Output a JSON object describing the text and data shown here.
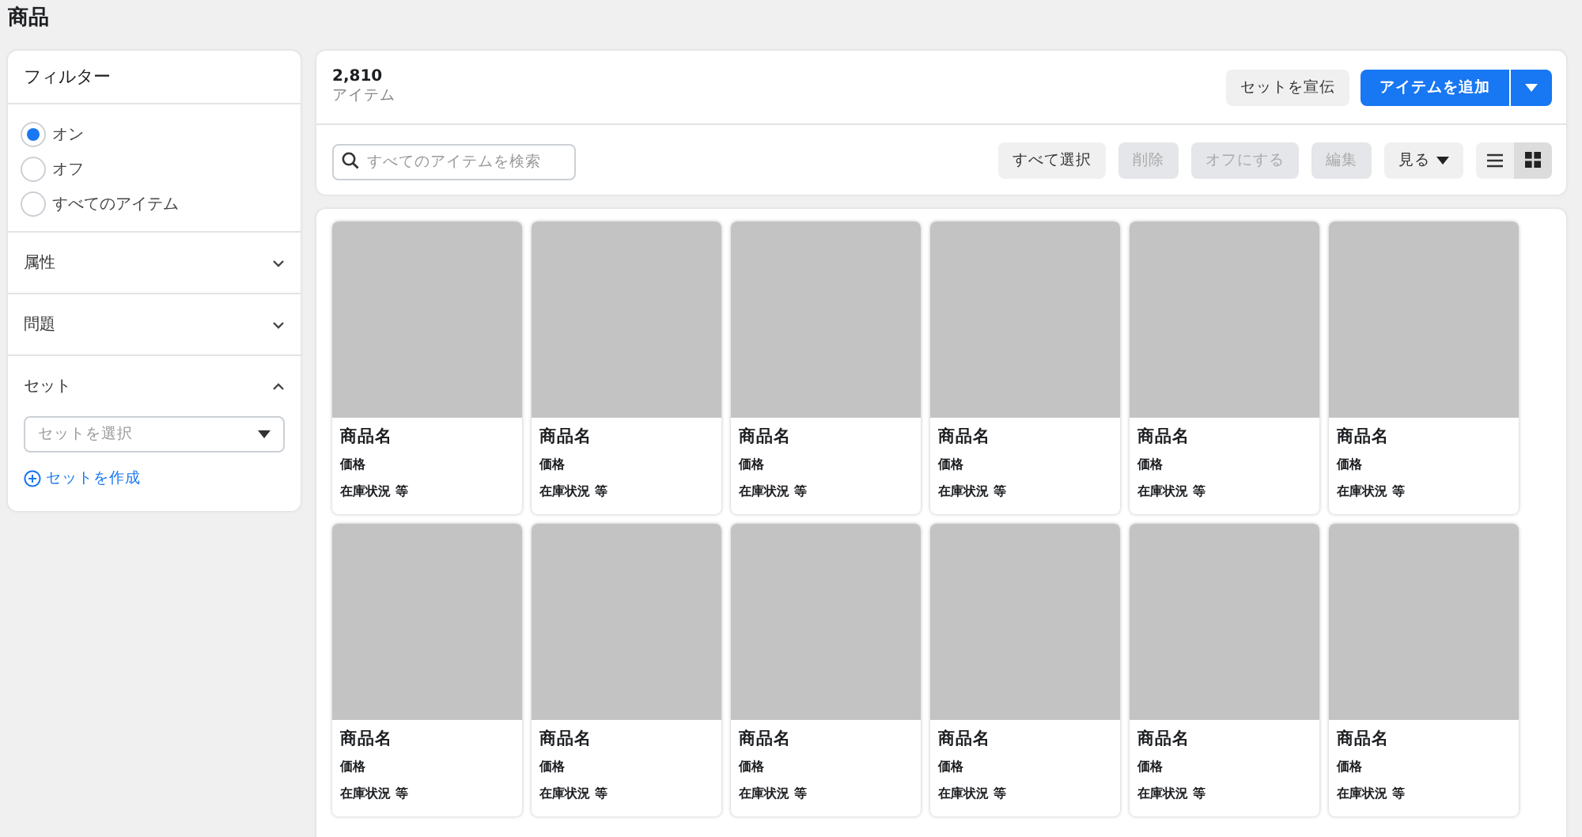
{
  "page_title": "商品",
  "filter": {
    "title": "フィルター",
    "options": [
      {
        "label": "オン",
        "selected": true
      },
      {
        "label": "オフ",
        "selected": false
      },
      {
        "label": "すべてのアイテム",
        "selected": false
      }
    ],
    "sections": [
      {
        "label": "属性",
        "expanded": false
      },
      {
        "label": "問題",
        "expanded": false
      },
      {
        "label": "セット",
        "expanded": true,
        "select_placeholder": "セットを選択",
        "link": "セットを作成"
      }
    ]
  },
  "summary": {
    "count": "2,810",
    "unit": "アイテム",
    "promote_button": "セットを宣伝",
    "add_button": "アイテムを追加"
  },
  "toolbar": {
    "search_placeholder": "すべてのアイテムを検索",
    "actions": [
      {
        "label": "すべて選択",
        "disabled": false
      },
      {
        "label": "削除",
        "disabled": true
      },
      {
        "label": "オフにする",
        "disabled": true
      },
      {
        "label": "編集",
        "disabled": true
      }
    ],
    "view_menu": "見る",
    "views": [
      {
        "kind": "list",
        "selected": false
      },
      {
        "kind": "grid",
        "selected": true
      }
    ]
  },
  "products": [
    {
      "name": "商品名",
      "price": "価格",
      "stock": "在庫状況 等"
    },
    {
      "name": "商品名",
      "price": "価格",
      "stock": "在庫状況 等"
    },
    {
      "name": "商品名",
      "price": "価格",
      "stock": "在庫状況 等"
    },
    {
      "name": "商品名",
      "price": "価格",
      "stock": "在庫状況 等"
    },
    {
      "name": "商品名",
      "price": "価格",
      "stock": "在庫状況 等"
    },
    {
      "name": "商品名",
      "price": "価格",
      "stock": "在庫状況 等"
    },
    {
      "name": "商品名",
      "price": "価格",
      "stock": "在庫状況 等"
    },
    {
      "name": "商品名",
      "price": "価格",
      "stock": "在庫状況 等"
    },
    {
      "name": "商品名",
      "price": "価格",
      "stock": "在庫状況 等"
    },
    {
      "name": "商品名",
      "price": "価格",
      "stock": "在庫状況 等"
    },
    {
      "name": "商品名",
      "price": "価格",
      "stock": "在庫状況 等"
    },
    {
      "name": "商品名",
      "price": "価格",
      "stock": "在庫状況 等"
    }
  ]
}
